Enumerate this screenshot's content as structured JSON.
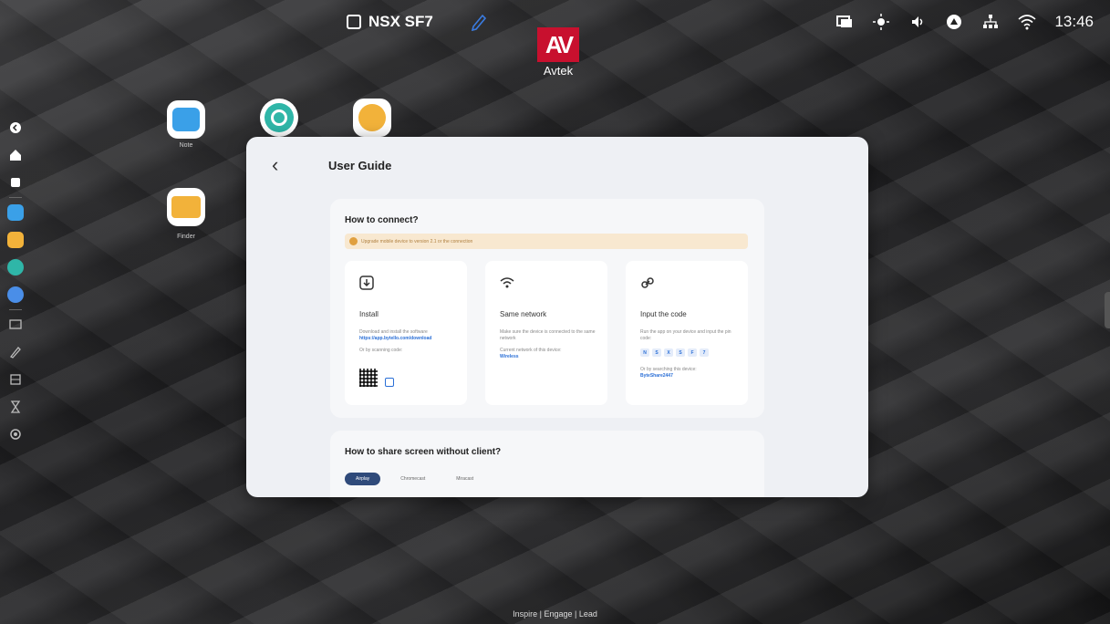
{
  "topbar": {
    "device_name": "NSX SF7",
    "time": "13:46",
    "icons": [
      "display-mirror-icon",
      "brightness-icon",
      "volume-icon",
      "vpn-icon",
      "network-icon",
      "wifi-icon"
    ]
  },
  "logo": {
    "mark": "AV",
    "brand": "Avtek"
  },
  "desktop_apps": [
    {
      "name": "Note",
      "icon": "whiteboard-icon",
      "color": "#3aa0e8"
    },
    {
      "name": "",
      "icon": "circle-app-icon",
      "color": "#2fb6a8"
    },
    {
      "name": "",
      "icon": "palette-icon",
      "color": "#f2b23a"
    },
    {
      "name": "Finder",
      "icon": "folder-icon",
      "color": "#f2b23a"
    }
  ],
  "dock": [
    "back-icon",
    "home-icon",
    "recents-icon",
    "chat-app-icon",
    "folder-app-icon",
    "circle-app-icon",
    "grid-app-icon",
    "screen-share-icon",
    "annotate-icon",
    "screenshot-icon",
    "timer-icon",
    "settings-icon"
  ],
  "dialog": {
    "title": "User Guide",
    "connect": {
      "heading": "How to connect?",
      "notice": "Upgrade mobile device to version 2.1 or the connection",
      "steps": [
        {
          "title": "Install",
          "desc": "Download and install the software",
          "link": "https://app.bytello.com/download",
          "extra": "Or by scanning code:"
        },
        {
          "title": "Same network",
          "desc": "Make sure the device is connected to the same network",
          "extra": "Current network of this device:",
          "link": "Wireless"
        },
        {
          "title": "Input the code",
          "desc": "Run the app on your device and input the pin code:",
          "pin": [
            "N",
            "S",
            "X",
            "S",
            "F",
            "7"
          ],
          "extra": "Or by searching this device:",
          "link": "ByteShare2447"
        }
      ]
    },
    "share": {
      "heading": "How to share screen without client?",
      "tabs": [
        "Airplay",
        "Chromecast",
        "Miracast"
      ]
    }
  },
  "footer": "Inspire | Engage | Lead"
}
